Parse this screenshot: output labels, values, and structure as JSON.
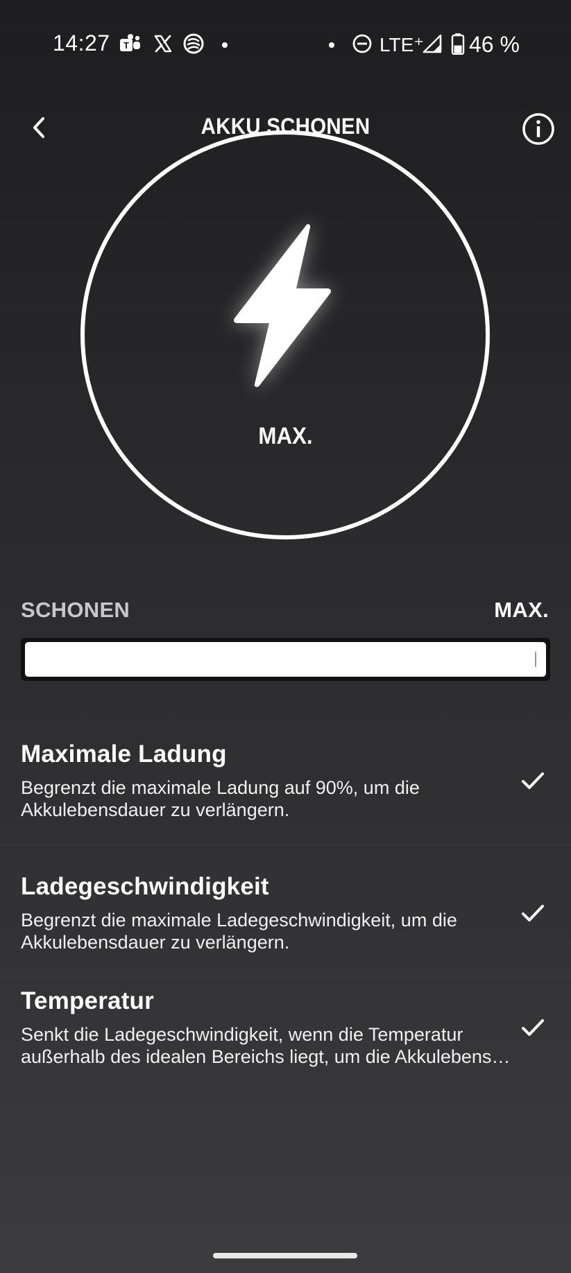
{
  "status_bar": {
    "time": "14:27",
    "network": "LTE⁺",
    "battery_percent": "46 %",
    "battery_level": 0.46,
    "icons": [
      "teams-icon",
      "x-icon",
      "app-icon",
      "dot-icon",
      "dot-icon",
      "do-not-disturb-icon",
      "signal-icon",
      "battery-icon"
    ]
  },
  "header": {
    "title": "AKKU SCHONEN"
  },
  "gauge": {
    "label": "MAX.",
    "icon": "lightning-bolt-icon"
  },
  "slider": {
    "left_label": "SCHONEN",
    "right_label": "MAX.",
    "value": 1.0
  },
  "options": [
    {
      "title": "Maximale Ladung",
      "description": "Begrenzt die maximale Ladung auf 90%, um die Akkulebensdauer zu verlängern.",
      "checked": true
    },
    {
      "title": "Ladegeschwindigkeit",
      "description": "Begrenzt die maximale Ladegeschwindigkeit, um die Akkulebensdauer zu verlängern.",
      "checked": true
    },
    {
      "title": "Temperatur",
      "description_line1": "Senkt die Ladegeschwindigkeit, wenn die Temperatur",
      "description_line2": "außerhalb des idealen Bereichs liegt, um die Akkulebensd…",
      "checked": true
    }
  ]
}
